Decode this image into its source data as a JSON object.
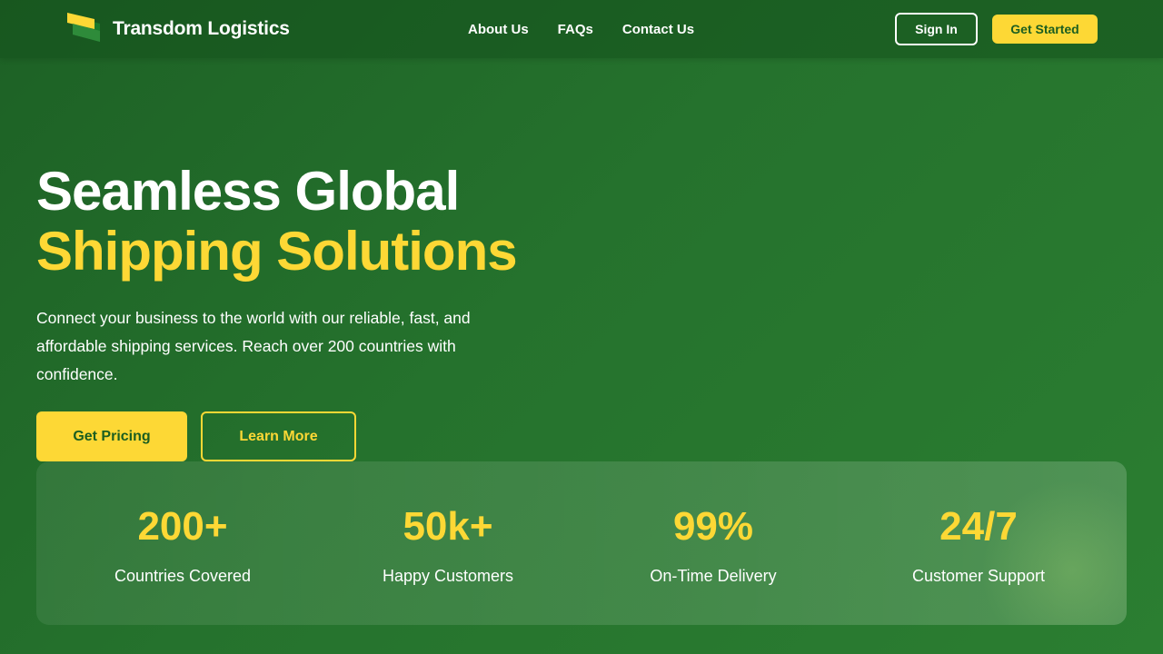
{
  "brand": {
    "name": "Transdom Logistics",
    "logo_icon": "flag-logo-icon"
  },
  "nav": {
    "links": [
      "About Us",
      "FAQs",
      "Contact Us"
    ],
    "signin_label": "Sign In",
    "get_started_label": "Get Started"
  },
  "hero": {
    "title_line1": "Seamless Global",
    "title_line2": "Shipping Solutions",
    "description": "Connect your business to the world with our reliable, fast, and affordable shipping services. Reach over 200 countries with confidence.",
    "primary_cta": "Get Pricing",
    "secondary_cta": "Learn More"
  },
  "stats": [
    {
      "value": "200+",
      "label": "Countries Covered"
    },
    {
      "value": "50k+",
      "label": "Happy Customers"
    },
    {
      "value": "99%",
      "label": "On-Time Delivery"
    },
    {
      "value": "24/7",
      "label": "Customer Support"
    }
  ],
  "colors": {
    "accent_yellow": "#fdd835",
    "primary_green": "#1b5e20",
    "background_green": "#25722d",
    "text_white": "#ffffff"
  }
}
